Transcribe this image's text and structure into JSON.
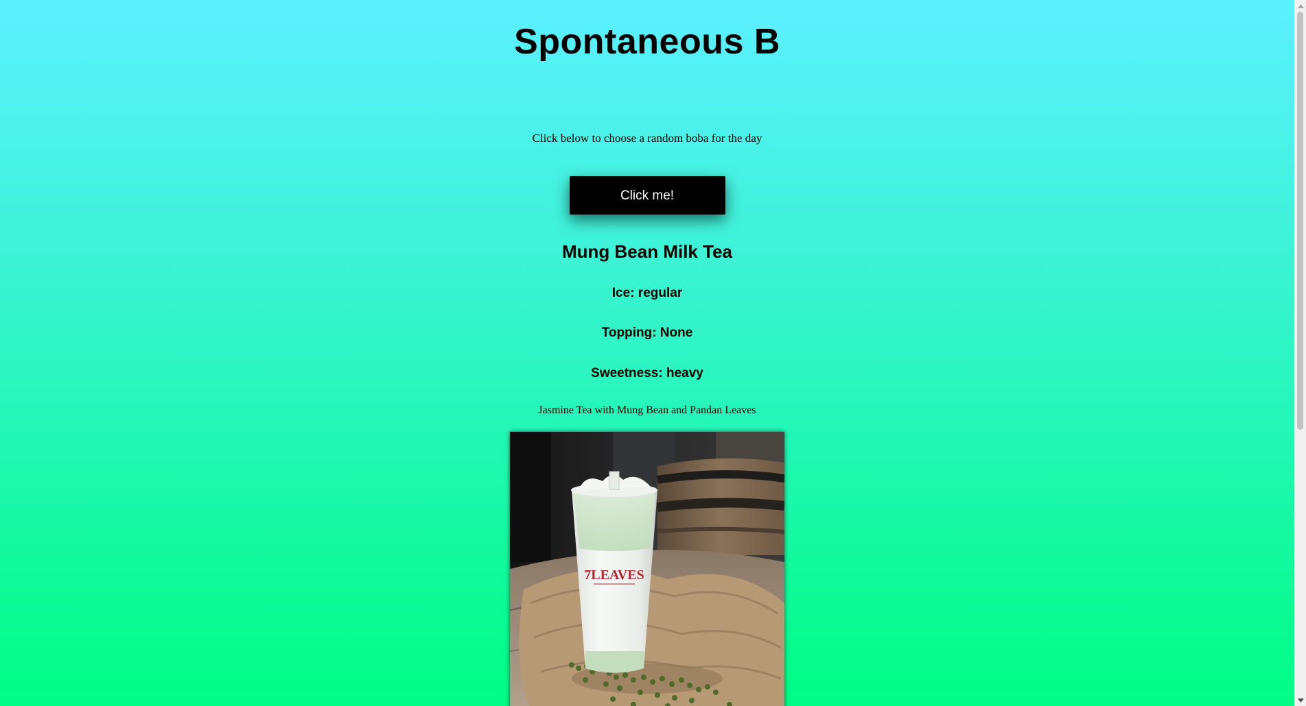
{
  "page": {
    "title": "Spontaneous B",
    "instruction": "Click below to choose a random boba for the day",
    "button_label": "Click me!"
  },
  "result": {
    "drink_name": "Mung Bean Milk Tea",
    "ice": "Ice: regular",
    "topping": "Topping: None",
    "sweetness": "Sweetness: heavy",
    "description": "Jasmine Tea with Mung Bean and Pandan Leaves",
    "photo_cup_logo": "7LEAVES"
  },
  "colors": {
    "background_top": "#5cf0ff",
    "background_bottom": "#00fd85",
    "button_background": "#000000",
    "button_text": "#ffffff"
  },
  "icons": {
    "scroll_up": "triangle-up-icon",
    "scroll_down": "triangle-down-icon"
  }
}
